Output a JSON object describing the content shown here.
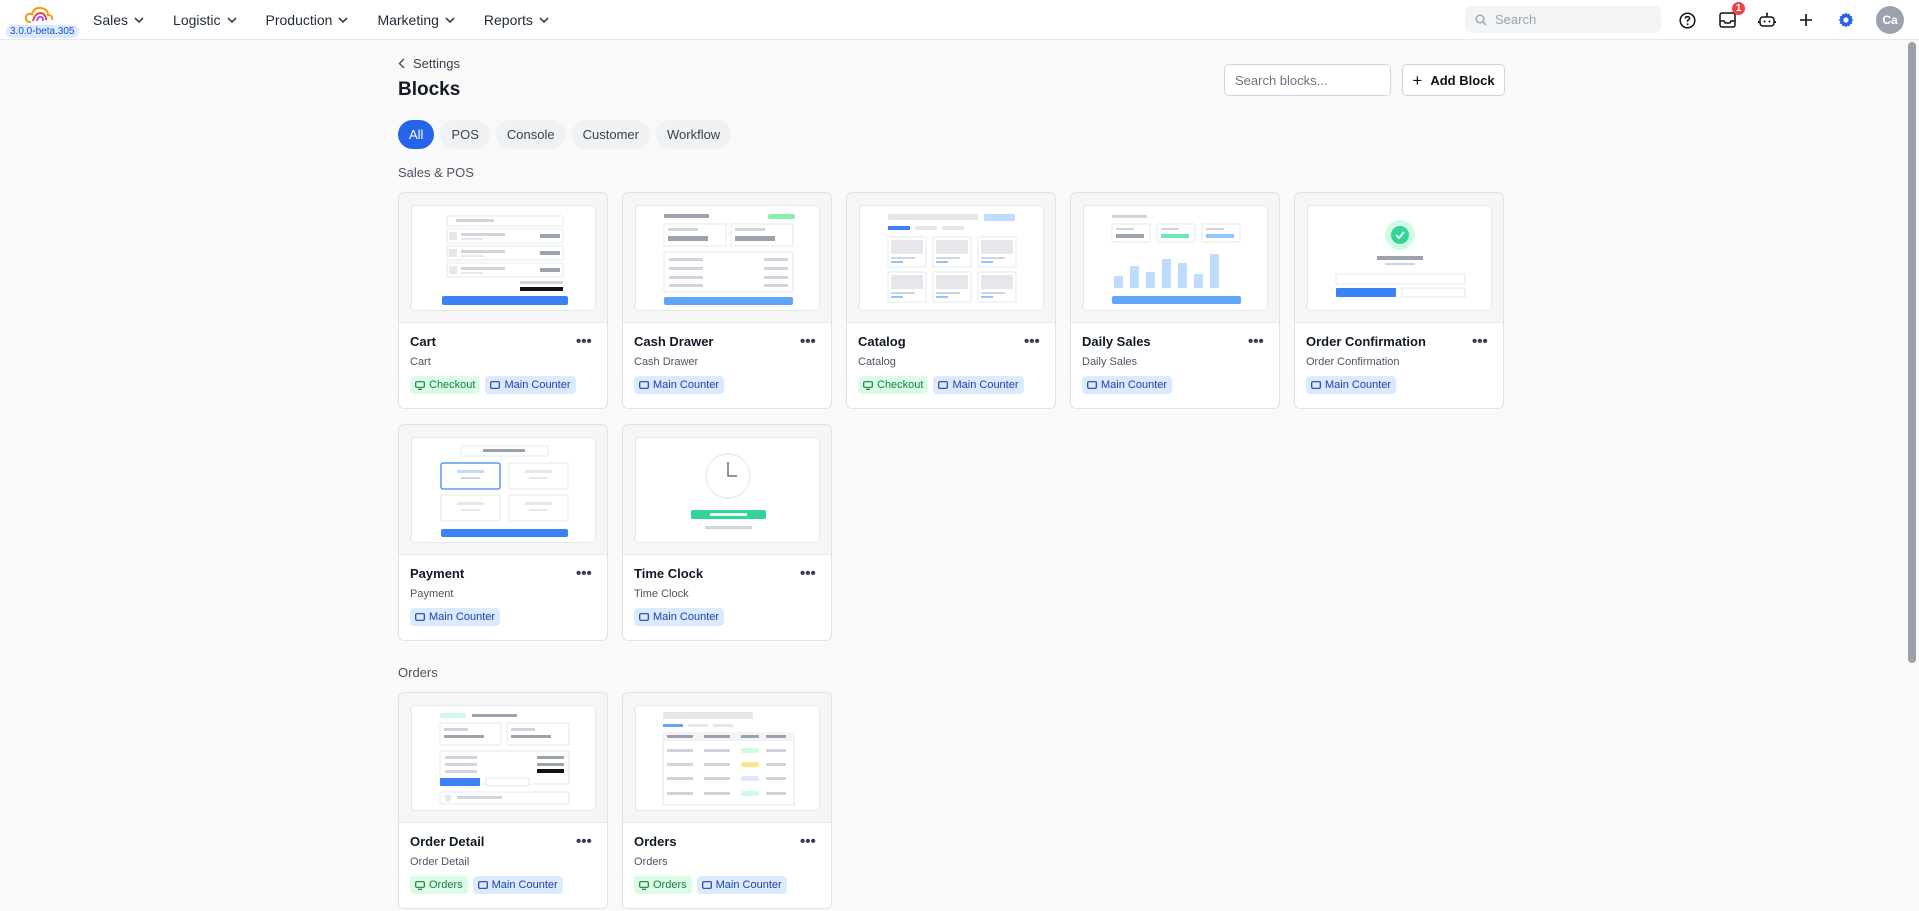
{
  "app": {
    "version": "3.0.0-beta.305"
  },
  "nav": [
    {
      "label": "Sales"
    },
    {
      "label": "Logistic"
    },
    {
      "label": "Production"
    },
    {
      "label": "Marketing"
    },
    {
      "label": "Reports"
    }
  ],
  "topbar": {
    "search_placeholder": "Search",
    "notification_count": "1",
    "avatar_initials": "Ca"
  },
  "page": {
    "breadcrumb": "Settings",
    "title": "Blocks",
    "search_placeholder": "Search blocks...",
    "add_label": "Add Block"
  },
  "tabs": [
    {
      "label": "All",
      "active": true
    },
    {
      "label": "POS"
    },
    {
      "label": "Console"
    },
    {
      "label": "Customer"
    },
    {
      "label": "Workflow"
    }
  ],
  "sections": [
    {
      "title": "Sales & POS",
      "cards": [
        {
          "name": "Cart",
          "subtitle": "Cart",
          "tags": [
            {
              "label": "Checkout",
              "color": "green"
            },
            {
              "label": "Main Counter",
              "color": "blue"
            }
          ]
        },
        {
          "name": "Cash Drawer",
          "subtitle": "Cash Drawer",
          "tags": [
            {
              "label": "Main Counter",
              "color": "blue"
            }
          ]
        },
        {
          "name": "Catalog",
          "subtitle": "Catalog",
          "tags": [
            {
              "label": "Checkout",
              "color": "green"
            },
            {
              "label": "Main Counter",
              "color": "blue"
            }
          ]
        },
        {
          "name": "Daily Sales",
          "subtitle": "Daily Sales",
          "tags": [
            {
              "label": "Main Counter",
              "color": "blue"
            }
          ]
        },
        {
          "name": "Order Confirmation",
          "subtitle": "Order Confirmation",
          "tags": [
            {
              "label": "Main Counter",
              "color": "blue"
            }
          ]
        },
        {
          "name": "Payment",
          "subtitle": "Payment",
          "tags": [
            {
              "label": "Main Counter",
              "color": "blue"
            }
          ]
        },
        {
          "name": "Time Clock",
          "subtitle": "Time Clock",
          "tags": [
            {
              "label": "Main Counter",
              "color": "blue"
            }
          ]
        }
      ]
    },
    {
      "title": "Orders",
      "cards": [
        {
          "name": "Order Detail",
          "subtitle": "Order Detail",
          "tags": [
            {
              "label": "Orders",
              "color": "green"
            },
            {
              "label": "Main Counter",
              "color": "blue"
            }
          ]
        },
        {
          "name": "Orders",
          "subtitle": "Orders",
          "tags": [
            {
              "label": "Orders",
              "color": "green"
            },
            {
              "label": "Main Counter",
              "color": "blue"
            }
          ]
        }
      ]
    }
  ],
  "colors": {
    "accent": "#2563eb",
    "green_tag": "#dcfce7",
    "blue_tag": "#dbeafe"
  }
}
